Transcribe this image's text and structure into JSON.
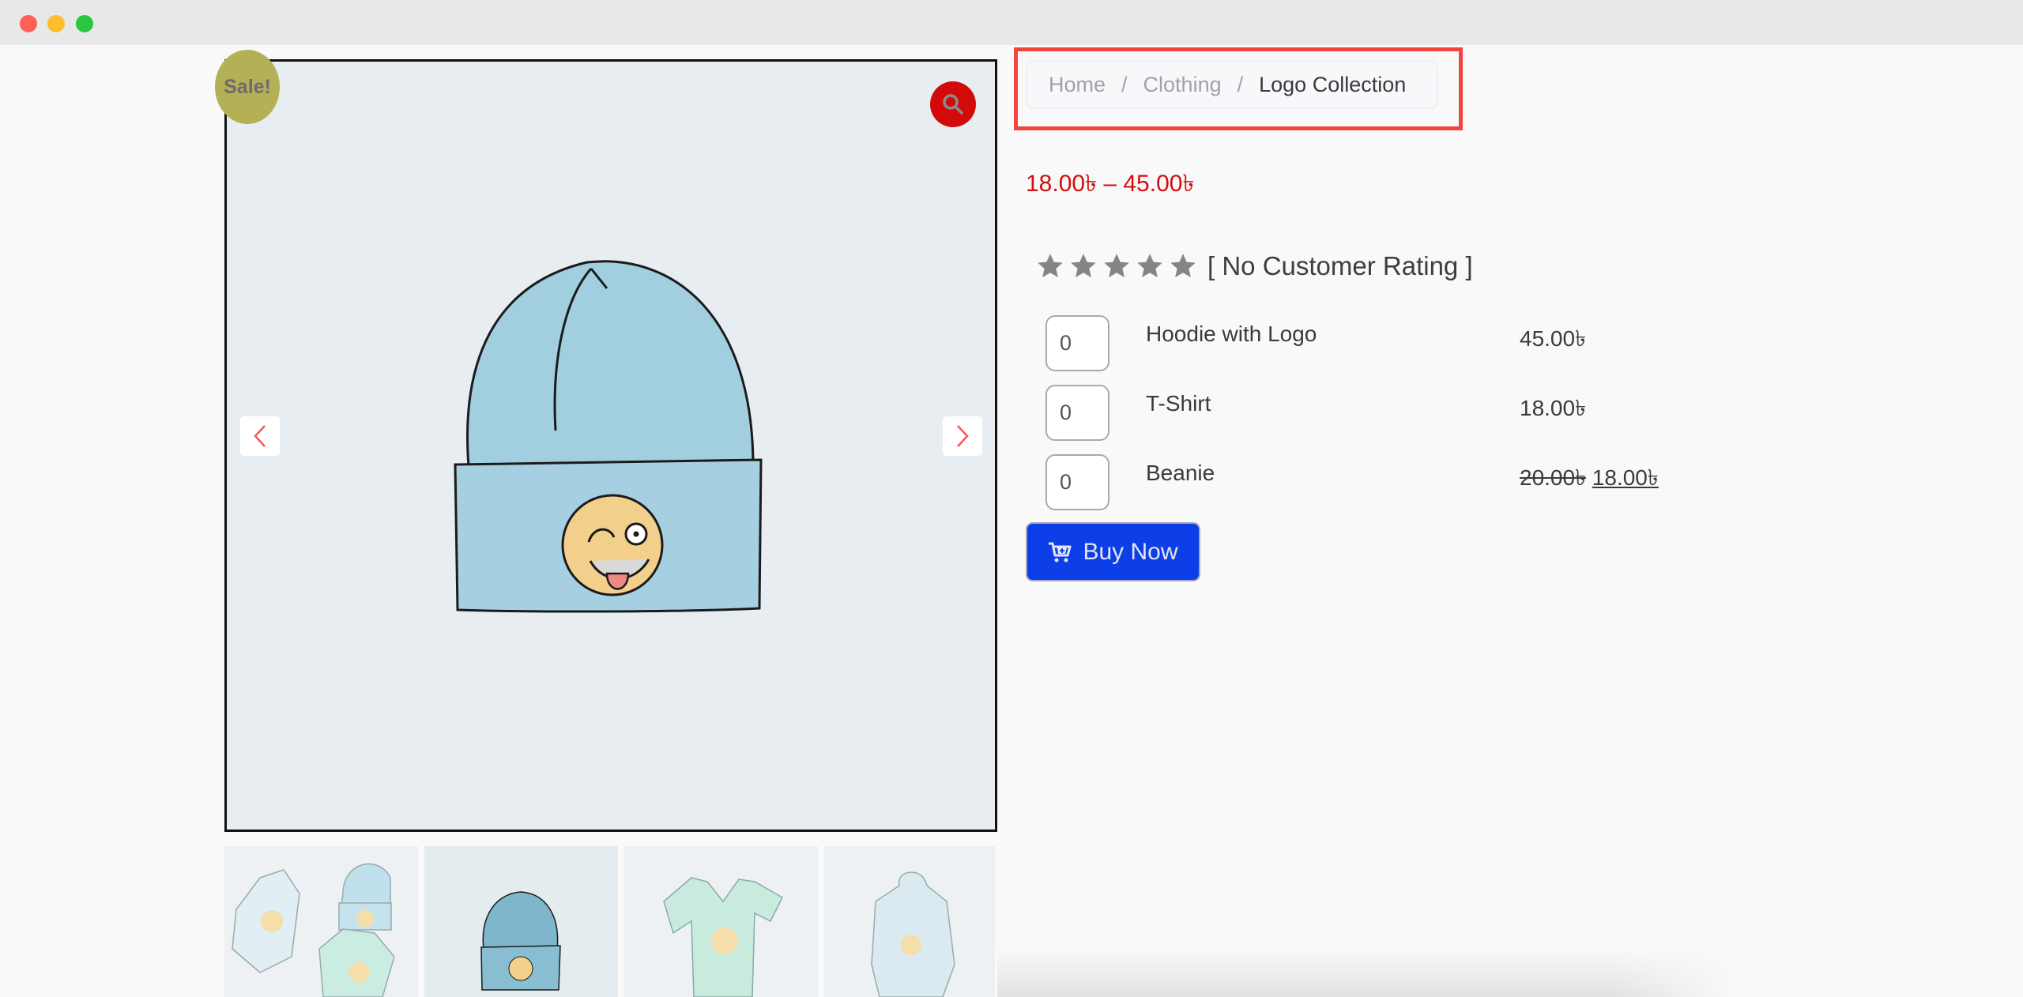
{
  "window": {
    "controls": [
      "close",
      "minimize",
      "maximize"
    ]
  },
  "gallery": {
    "sale_badge": "Sale!",
    "zoom_icon": "search-icon",
    "prev_icon": "chevron-left-icon",
    "next_icon": "chevron-right-icon",
    "main_image": "beanie-with-logo",
    "thumbnails": [
      {
        "name": "logo-collection-group",
        "active": false
      },
      {
        "name": "beanie",
        "active": true
      },
      {
        "name": "t-shirt",
        "active": false
      },
      {
        "name": "hoodie-with-logo",
        "active": false
      }
    ]
  },
  "breadcrumb": {
    "items": [
      "Home",
      "Clothing"
    ],
    "separator": "/",
    "current": "Logo Collection"
  },
  "product": {
    "price_range": "18.00৳  – 45.00৳",
    "rating": {
      "stars_filled": 0,
      "stars_total": 5,
      "label": "[ No Customer Rating ]"
    },
    "variants": [
      {
        "qty": "0",
        "name": "Hoodie with Logo",
        "price": "45.00৳",
        "regular_price": null
      },
      {
        "qty": "0",
        "name": "T-Shirt",
        "price": "18.00৳",
        "regular_price": null
      },
      {
        "qty": "0",
        "name": "Beanie",
        "price": "18.00৳",
        "regular_price": "20.00৳"
      }
    ],
    "buy_label": "Buy Now",
    "buy_icon": "cart-plus-icon"
  },
  "colors": {
    "price_red": "#d50c0c",
    "buy_blue": "#0c3fe8",
    "sale_badge": "#b3b055",
    "highlight_red": "#f1453d"
  }
}
